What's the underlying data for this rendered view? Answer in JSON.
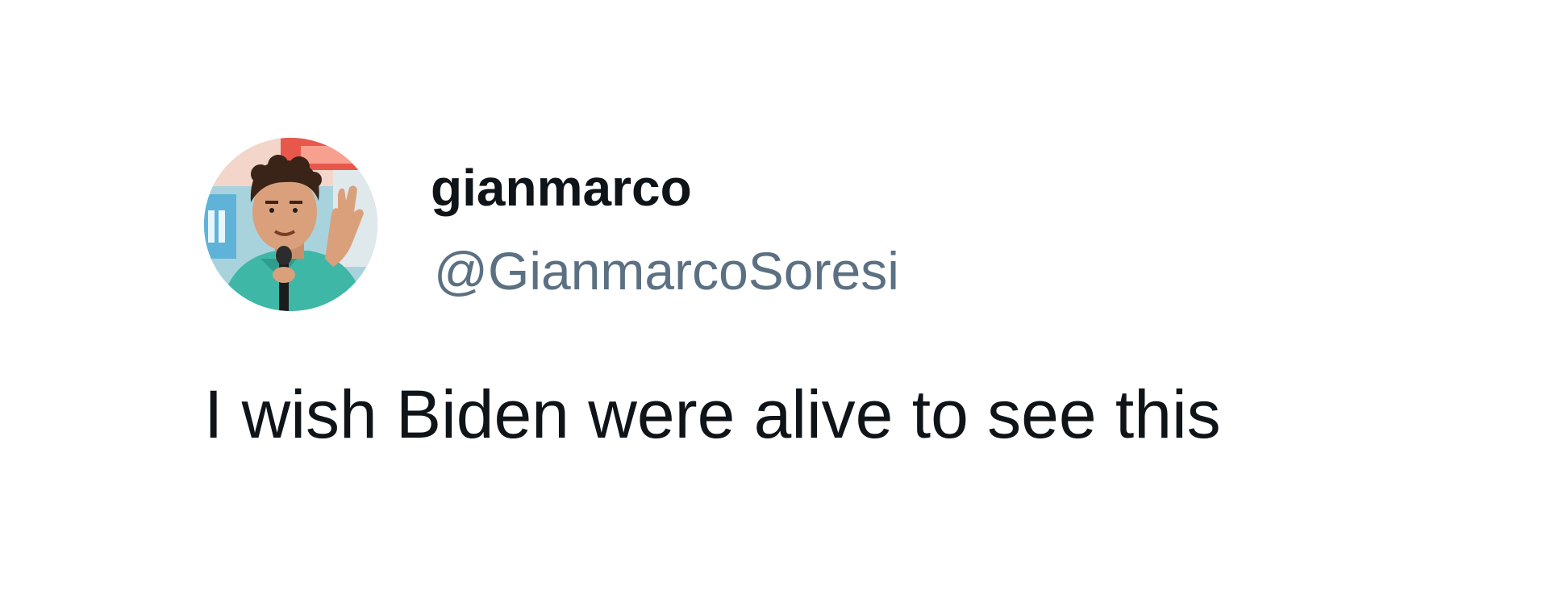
{
  "tweet": {
    "author": {
      "display_name": "gianmarco",
      "handle": "@GianmarcoSoresi",
      "avatar_icon": "profile-photo"
    },
    "text": "I wish Biden were alive to see this"
  },
  "colors": {
    "background": "#ffffff",
    "name_text": "#0f1419",
    "handle_text": "#5b7083",
    "body_text": "#0f1419"
  }
}
